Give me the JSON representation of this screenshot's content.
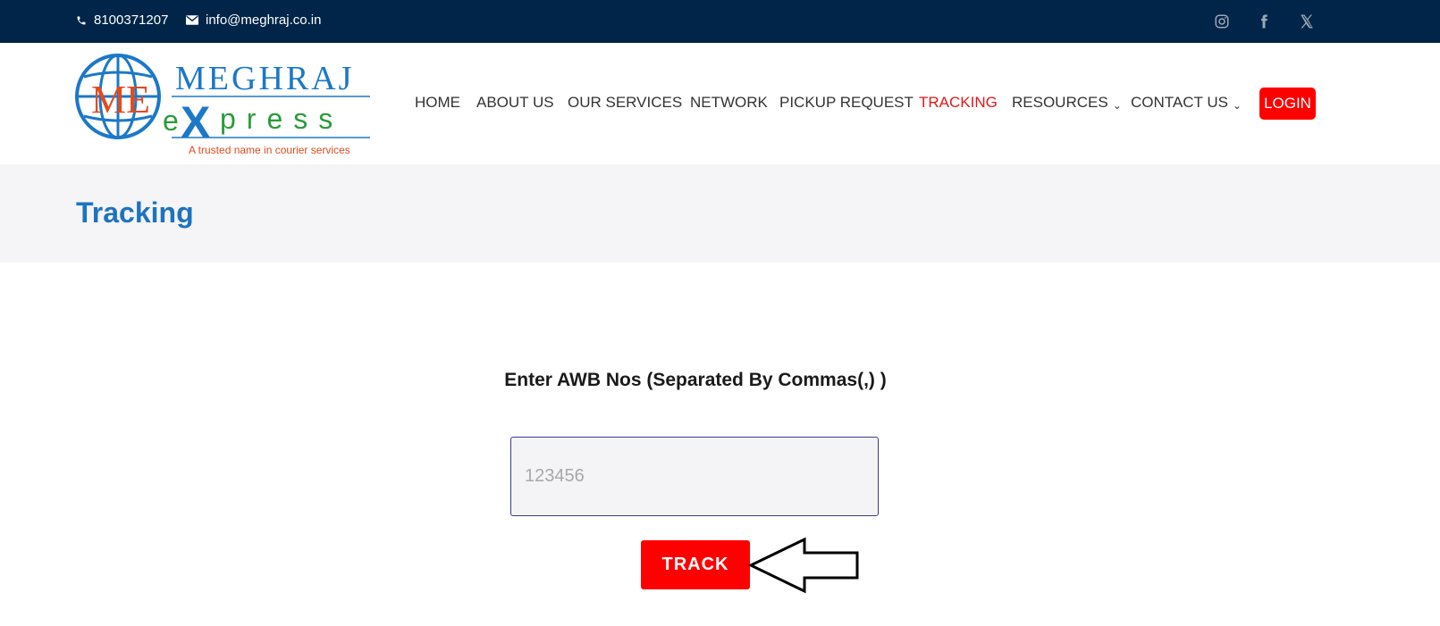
{
  "topbar": {
    "phone": "8100371207",
    "email": "info@meghraj.co.in",
    "social": [
      "instagram-icon",
      "facebook-icon",
      "x-icon"
    ]
  },
  "logo": {
    "name": "MEGHRAJ",
    "sub_e": "e",
    "sub_x": "X",
    "sub_rest": "press",
    "tagline": "A trusted name in courier services",
    "monogram": "ME"
  },
  "nav": {
    "items": [
      {
        "label": "HOME"
      },
      {
        "label": "ABOUT US"
      },
      {
        "label": "OUR SERVICES"
      },
      {
        "label": "NETWORK"
      },
      {
        "label": "PICKUP REQUEST"
      },
      {
        "label": "TRACKING"
      },
      {
        "label": "RESOURCES"
      },
      {
        "label": "CONTACT US"
      }
    ],
    "caret": "⌄",
    "login": "LOGIN"
  },
  "page": {
    "title": "Tracking"
  },
  "form": {
    "label": "Enter AWB Nos (Separated By Commas(,) )",
    "placeholder": "123456",
    "value": "",
    "button": "TRACK"
  },
  "colors": {
    "topbar": "#002548",
    "accent": "#ff0000",
    "title": "#1e73be",
    "active_nav": "#e01919"
  }
}
